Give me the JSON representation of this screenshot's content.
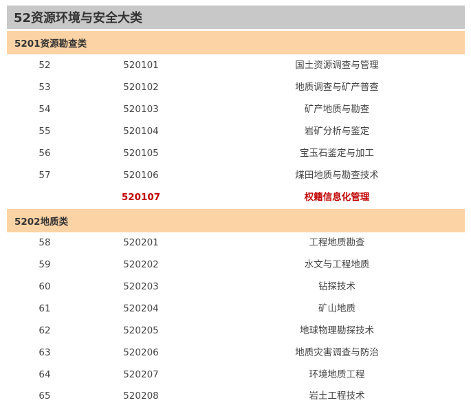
{
  "title": "52资源环境与安全大类",
  "sections": [
    {
      "header": "5201资源勘查类",
      "rows": [
        {
          "num": "52",
          "code": "520101",
          "name": "国土资源调查与管理"
        },
        {
          "num": "53",
          "code": "520102",
          "name": "地质调查与矿产普查"
        },
        {
          "num": "54",
          "code": "520103",
          "name": "矿产地质与勘查"
        },
        {
          "num": "55",
          "code": "520104",
          "name": "岩矿分析与鉴定"
        },
        {
          "num": "56",
          "code": "520105",
          "name": "宝玉石鉴定与加工"
        },
        {
          "num": "57",
          "code": "520106",
          "name": "煤田地质与勘查技术"
        },
        {
          "num": "",
          "code": "520107",
          "name": "权籍信息化管理",
          "highlight": true
        }
      ]
    },
    {
      "header": "5202地质类",
      "rows": [
        {
          "num": "58",
          "code": "520201",
          "name": "工程地质勘查"
        },
        {
          "num": "59",
          "code": "520202",
          "name": "水文与工程地质"
        },
        {
          "num": "60",
          "code": "520203",
          "name": "钻探技术"
        },
        {
          "num": "61",
          "code": "520204",
          "name": "矿山地质"
        },
        {
          "num": "62",
          "code": "520205",
          "name": "地球物理勘探技术"
        },
        {
          "num": "63",
          "code": "520206",
          "name": "地质灾害调查与防治"
        },
        {
          "num": "64",
          "code": "520207",
          "name": "环境地质工程"
        },
        {
          "num": "65",
          "code": "520208",
          "name": "岩土工程技术"
        }
      ]
    }
  ]
}
